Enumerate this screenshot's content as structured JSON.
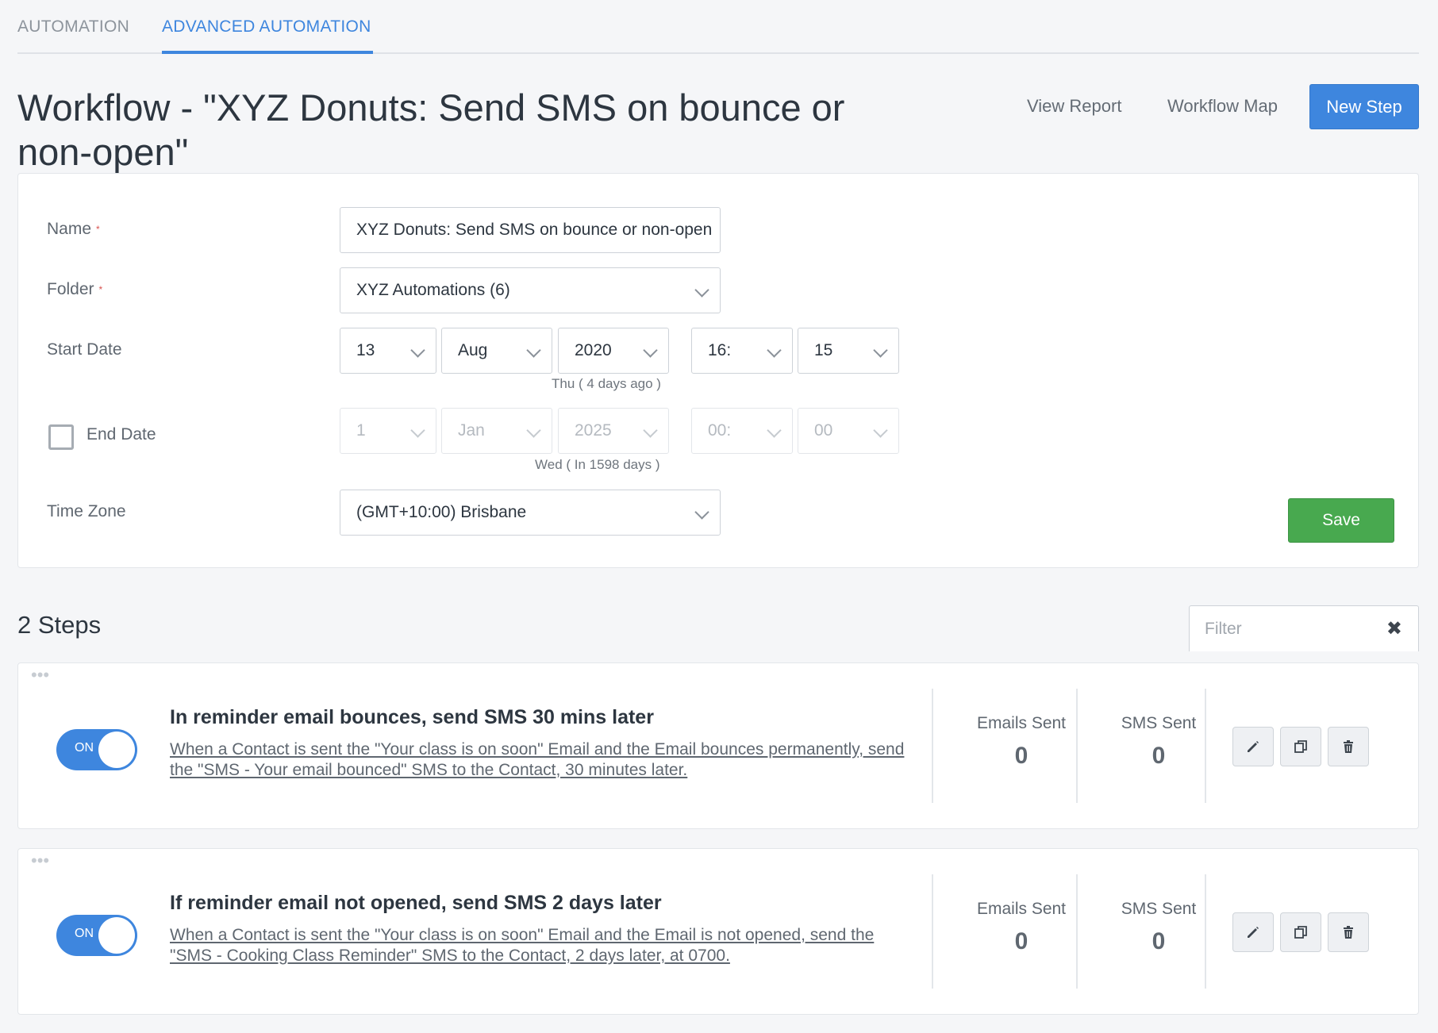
{
  "tabs": [
    {
      "label": "AUTOMATION"
    },
    {
      "label": "ADVANCED AUTOMATION"
    }
  ],
  "header": {
    "title": "Workflow - \"XYZ Donuts: Send SMS on bounce or non-open\"",
    "view_report": "View Report",
    "workflow_map": "Workflow Map",
    "new_step": "New Step"
  },
  "form": {
    "name_label": "Name",
    "name_value": "XYZ Donuts: Send SMS on bounce or non-open",
    "folder_label": "Folder",
    "folder_value": "XYZ Automations (6)",
    "required_mark": "*",
    "start_date_label": "Start Date",
    "start": {
      "day": "13",
      "month": "Aug",
      "year": "2020",
      "hour": "16:",
      "minute": "15",
      "hint": "Thu ( 4 days ago )"
    },
    "end_date_label": "End Date",
    "end_date_checked": false,
    "end": {
      "day": "1",
      "month": "Jan",
      "year": "2025",
      "hour": "00:",
      "minute": "00",
      "hint": "Wed ( In 1598 days )"
    },
    "timezone_label": "Time Zone",
    "timezone_value": "(GMT+10:00) Brisbane",
    "save": "Save"
  },
  "steps_section": {
    "title": "2 Steps",
    "filter_placeholder": "Filter",
    "clear_icon": "close-icon"
  },
  "steps": [
    {
      "toggle": "ON",
      "title": "In reminder email bounces, send SMS 30 mins later",
      "description": "When a Contact is sent the \"Your class is on soon\" Email and the Email bounces permanently, send the \"SMS - Your email bounced\" SMS to the Contact, 30 minutes later.",
      "emails_sent_label": "Emails Sent",
      "emails_sent": "0",
      "sms_sent_label": "SMS Sent",
      "sms_sent": "0"
    },
    {
      "toggle": "ON",
      "title": "If reminder email not opened, send SMS 2 days later",
      "description": "When a Contact is sent the \"Your class is on soon\" Email and the Email is not opened, send the \"SMS - Cooking Class Reminder\" SMS to the Contact, 2 days later, at 0700.",
      "emails_sent_label": "Emails Sent",
      "emails_sent": "0",
      "sms_sent_label": "SMS Sent",
      "sms_sent": "0"
    }
  ],
  "colors": {
    "accent": "#3e86de",
    "save": "#48a94f",
    "background": "#f5f6f8"
  }
}
